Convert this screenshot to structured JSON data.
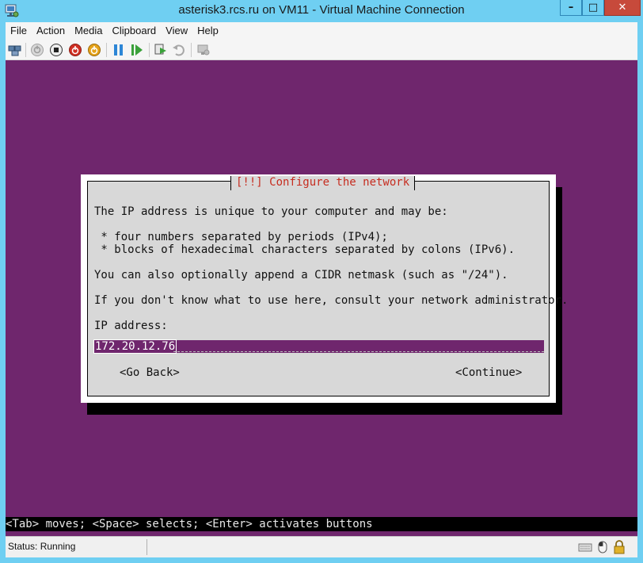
{
  "window": {
    "title": "asterisk3.rcs.ru on VM11 - Virtual Machine Connection",
    "minimize": "–",
    "maximize": "□",
    "close": "✕"
  },
  "menu": [
    "File",
    "Action",
    "Media",
    "Clipboard",
    "View",
    "Help"
  ],
  "toolbar": {
    "icons": [
      "ctrl-alt-del-icon",
      "start-icon",
      "turn-off-icon",
      "shut-down-icon",
      "save-icon",
      "pause-icon",
      "reset-icon",
      "checkpoint-icon",
      "revert-icon",
      "enhanced-session-icon"
    ]
  },
  "dialog": {
    "title": "[!!] Configure the network",
    "line1": "The IP address is unique to your computer and may be:",
    "bullet1": " * four numbers separated by periods (IPv4);",
    "bullet2": " * blocks of hexadecimal characters separated by colons (IPv6).",
    "line2": "You can also optionally append a CIDR netmask (such as \"/24\").",
    "line3": "If you don't know what to use here, consult your network administrator.",
    "field_label": "IP address:",
    "ip_value": "172.20.12.76",
    "go_back": "<Go Back>",
    "continue": "<Continue>"
  },
  "hint": "<Tab> moves; <Space> selects; <Enter> activates buttons",
  "status": {
    "text": "Status: Running",
    "icons": [
      "keyboard-icon",
      "mouse-icon",
      "lock-icon"
    ]
  },
  "colors": {
    "console_bg": "#6f266d",
    "dialog_bg": "#d8d8d8",
    "title_red": "#c62d20"
  }
}
